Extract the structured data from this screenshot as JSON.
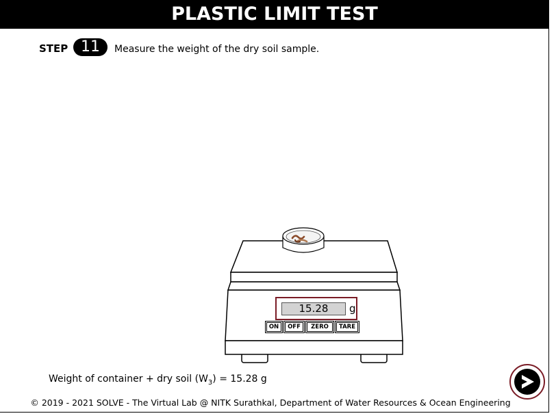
{
  "page": {
    "title": "PLASTIC LIMIT TEST",
    "footer": "© 2019 - 2021 SOLVE - The Virtual Lab @ NITK Surathkal, Department of Water Resources & Ocean Engineering"
  },
  "step": {
    "label": "STEP",
    "number": "11",
    "instruction": "Measure the weight of the dry soil sample."
  },
  "scale": {
    "reading": "15.28",
    "unit": "g",
    "buttons": {
      "on": "ON",
      "off": "OFF",
      "zero": "ZERO",
      "tare": "TARE"
    }
  },
  "result": {
    "prefix": "Weight of container + dry soil (W",
    "subscript": "3",
    "suffix": ") = 15.28 g"
  },
  "colors": {
    "accent": "#7a1c26",
    "screen": "#d3d3d3",
    "title_bg": "#000000"
  },
  "icons": {
    "next": "next-arrow-icon"
  }
}
